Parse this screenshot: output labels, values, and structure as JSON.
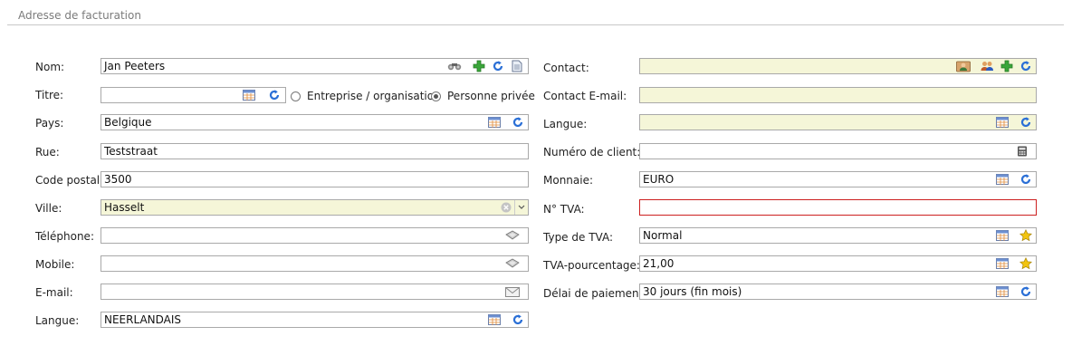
{
  "section": {
    "title": "Adresse de facturation"
  },
  "left": {
    "nom": {
      "label": "Nom:",
      "value": "Jan Peeters"
    },
    "titre": {
      "label": "Titre:",
      "value": ""
    },
    "type_options": {
      "org_label": "Entreprise / organisation",
      "person_label": "Personne privée",
      "selected": "person"
    },
    "pays": {
      "label": "Pays:",
      "value": "Belgique"
    },
    "rue": {
      "label": "Rue:",
      "value": "Teststraat"
    },
    "code_postal": {
      "label": "Code postal:",
      "value": "3500"
    },
    "ville": {
      "label": "Ville:",
      "value": "Hasselt"
    },
    "telephone": {
      "label": "Téléphone:",
      "value": ""
    },
    "mobile": {
      "label": "Mobile:",
      "value": ""
    },
    "email": {
      "label": "E-mail:",
      "value": ""
    },
    "langue": {
      "label": "Langue:",
      "value": "NEERLANDAIS"
    }
  },
  "right": {
    "contact": {
      "label": "Contact:",
      "value": ""
    },
    "contact_email": {
      "label": "Contact E-mail:",
      "value": ""
    },
    "langue": {
      "label": "Langue:",
      "value": ""
    },
    "numero_client": {
      "label": "Numéro de client:",
      "value": ""
    },
    "monnaie": {
      "label": "Monnaie:",
      "value": "EURO"
    },
    "tva": {
      "label": "N° TVA:",
      "value": ""
    },
    "type_tva": {
      "label": "Type de TVA:",
      "value": "Normal"
    },
    "tva_pourcentage": {
      "label": "TVA-pourcentage:",
      "value": "21,00"
    },
    "delai_paiement": {
      "label": "Délai de paiement:",
      "value": "30 jours (fin mois)"
    }
  },
  "colors": {
    "yellow_field": "#f5f6d8",
    "error_border": "#cc2020",
    "add_green": "#3aa63a",
    "refresh_blue": "#2a6fd6",
    "star": "#f2c40f"
  }
}
